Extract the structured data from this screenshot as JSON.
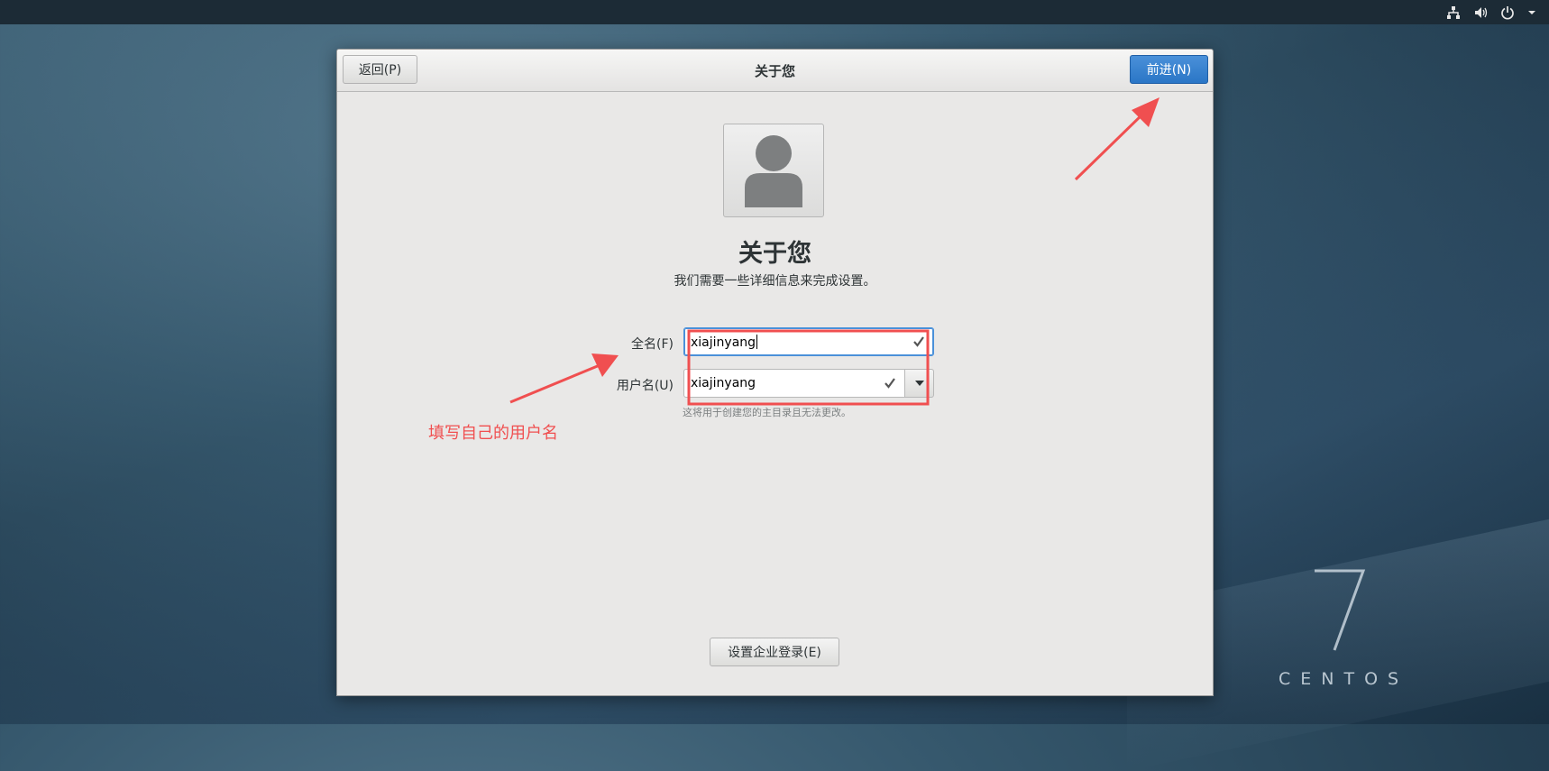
{
  "desktop": {
    "brand_number": "7",
    "brand_word": "CENTOS",
    "tray_icons": [
      "network-icon",
      "volume-icon",
      "power-icon",
      "chevron-down-icon"
    ]
  },
  "window": {
    "title": "关于您",
    "back_label": "返回(P)",
    "next_label": "前进(N)",
    "heading": "关于您",
    "subheading": "我们需要一些详细信息来完成设置。",
    "full_name": {
      "label": "全名(F)",
      "value": "xiajinyang"
    },
    "username": {
      "label": "用户名(U)",
      "value": "xiajinyang"
    },
    "hint": "这将用于创建您的主目录且无法更改。",
    "enterprise_label": "设置企业登录(E)"
  },
  "annotation": {
    "text": "填写自己的用户名",
    "color": "#f04f50"
  },
  "colors": {
    "accent": "#4a90d9",
    "annotation_red": "#f04f50"
  }
}
